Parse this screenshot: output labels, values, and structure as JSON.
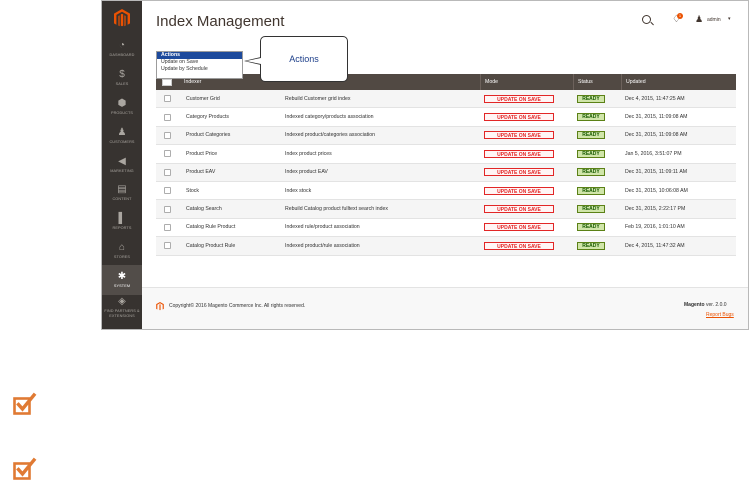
{
  "nav": {
    "items": [
      {
        "label": "Dashboard",
        "icon": "gauge-icon",
        "glyph": "◔"
      },
      {
        "label": "Sales",
        "icon": "dollar-icon",
        "glyph": "$"
      },
      {
        "label": "Products",
        "icon": "cube-icon",
        "glyph": "⬢"
      },
      {
        "label": "Customers",
        "icon": "person-icon",
        "glyph": "♟"
      },
      {
        "label": "Marketing",
        "icon": "megaphone-icon",
        "glyph": "◀"
      },
      {
        "label": "Content",
        "icon": "layout-icon",
        "glyph": "▤"
      },
      {
        "label": "Reports",
        "icon": "bar-chart-icon",
        "glyph": "▌"
      },
      {
        "label": "Stores",
        "icon": "store-icon",
        "glyph": "⌂"
      },
      {
        "label": "System",
        "icon": "gear-icon",
        "glyph": "✱"
      },
      {
        "label": "Find Partners & Extensions",
        "icon": "box-icon",
        "glyph": "◈"
      }
    ]
  },
  "header": {
    "title": "Index Management",
    "user": "admin",
    "notification_count": "1"
  },
  "actions": {
    "options": [
      "Actions",
      "Update on Save",
      "Update by Schedule"
    ],
    "callout": "Actions"
  },
  "grid": {
    "columns": [
      "Indexer",
      "Mode",
      "Status",
      "Updated"
    ],
    "rows": [
      {
        "name": "Customer Grid",
        "description": "Rebuild Customer grid index",
        "mode": "UPDATE ON SAVE",
        "status": "READY",
        "updated": "Dec 4, 2015, 11:47:25 AM"
      },
      {
        "name": "Category Products",
        "description": "Indexed category/products association",
        "mode": "UPDATE ON SAVE",
        "status": "READY",
        "updated": "Dec 31, 2015, 11:09:08 AM"
      },
      {
        "name": "Product Categories",
        "description": "Indexed product/categories association",
        "mode": "UPDATE ON SAVE",
        "status": "READY",
        "updated": "Dec 31, 2015, 11:09:08 AM"
      },
      {
        "name": "Product Price",
        "description": "Index product prices",
        "mode": "UPDATE ON SAVE",
        "status": "READY",
        "updated": "Jan 5, 2016, 3:51:07 PM"
      },
      {
        "name": "Product EAV",
        "description": "Index product EAV",
        "mode": "UPDATE ON SAVE",
        "status": "READY",
        "updated": "Dec 31, 2015, 11:09:11 AM"
      },
      {
        "name": "Stock",
        "description": "Index stock",
        "mode": "UPDATE ON SAVE",
        "status": "READY",
        "updated": "Dec 31, 2015, 10:06:08 AM"
      },
      {
        "name": "Catalog Search",
        "description": "Rebuild Catalog product fulltext search index",
        "mode": "UPDATE ON SAVE",
        "status": "READY",
        "updated": "Dec 31, 2015, 2:22:17 PM"
      },
      {
        "name": "Catalog Rule Product",
        "description": "Indexed rule/product association",
        "mode": "UPDATE ON SAVE",
        "status": "READY",
        "updated": "Feb 19, 2016, 1:01:10 AM"
      },
      {
        "name": "Catalog Product Rule",
        "description": "Indexed product/rule association",
        "mode": "UPDATE ON SAVE",
        "status": "READY",
        "updated": "Dec 4, 2015, 11:47:32 AM"
      }
    ]
  },
  "footer": {
    "copyright": "Copyright© 2016 Magento Commerce Inc. All rights reserved.",
    "brand": "Magento",
    "version": "ver. 2.0.0",
    "report_bugs": "Report Bugs"
  },
  "colors": {
    "nav_bg": "#373330",
    "accent": "#eb5202",
    "mode_red": "#e22626",
    "status_green": "#5b8116",
    "check_orange": "#e07a33"
  }
}
